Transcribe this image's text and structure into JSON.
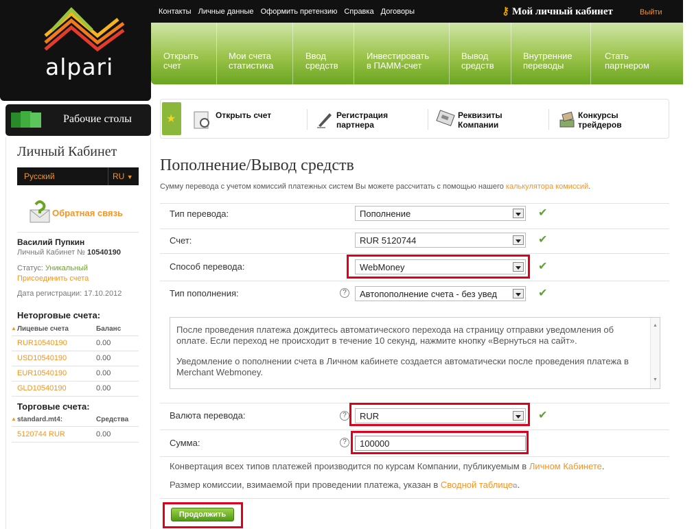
{
  "logo_text": "alpari",
  "sidebar": {
    "desks_label": "Рабочие столы",
    "cabinet_title": "Личный Кабинет",
    "language": "Русский",
    "language_code": "RU",
    "feedback": "Обратная связь",
    "user_name": "Василий Пупкин",
    "cabinet_no_label": "Личный Кабинет №",
    "cabinet_no": "10540190",
    "status_label": "Статус:",
    "status_value": "Уникальный",
    "join_accounts": "Присоединить счета",
    "reg_date": "Дата регистрации: 17.10.2012",
    "nontrading_title": "Неторговые счета:",
    "nontrading_cols": [
      "Лицевые счета",
      "Баланс"
    ],
    "nontrading_rows": [
      {
        "account": "RUR10540190",
        "balance": "0.00"
      },
      {
        "account": "USD10540190",
        "balance": "0.00"
      },
      {
        "account": "EUR10540190",
        "balance": "0.00"
      },
      {
        "account": "GLD10540190",
        "balance": "0.00"
      }
    ],
    "trading_title": "Торговые счета:",
    "trading_cols": [
      "standard.mt4:",
      "Средства"
    ],
    "trading_rows": [
      {
        "account": "5120744 RUR",
        "balance": "0.00"
      }
    ]
  },
  "topbar": {
    "links": [
      "Контакты",
      "Личные данные",
      "Оформить претензию",
      "Справка",
      "Договоры"
    ],
    "cabinet": "Мой личный кабинет",
    "exit": "Выйти"
  },
  "nav": [
    [
      "Открыть",
      "счет"
    ],
    [
      "Мои счета",
      "статистика"
    ],
    [
      "Ввод",
      "средств"
    ],
    [
      "Инвестировать",
      "в ПАММ-счет"
    ],
    [
      "Вывод",
      "средств"
    ],
    [
      "Внутренние",
      "переводы"
    ],
    [
      "Стать",
      "партнером"
    ]
  ],
  "quick_tabs": [
    [
      "Открыть счет",
      ""
    ],
    [
      "Регистрация",
      "партнера"
    ],
    [
      "Реквизиты",
      "Компании"
    ],
    [
      "Конкурсы",
      "трейдеров"
    ]
  ],
  "page": {
    "title": "Пополнение/Вывод средств",
    "intro": "Сумму перевода с учетом комиссий платежных систем Вы можете рассчитать с помощью нашего",
    "intro_link": "калькулятора комиссий",
    "intro_end": ".",
    "transfer_type_label": "Тип перевода:",
    "transfer_type_value": "Пополнение",
    "account_label": "Счет:",
    "account_value": "RUR 5120744",
    "method_label": "Способ перевода:",
    "method_value": "WebMoney",
    "deposit_type_label": "Тип пополнения:",
    "deposit_type_value": "Автопополнение счета - без увед",
    "info_p1": "После проведения платежа дождитесь автоматического перехода на страницу отправки уведомления об оплате. Если переход не происходит в течение 10 секунд, нажмите кнопку «Вернуться на сайт».",
    "info_p2": "Уведомление о пополнении счета в Личном кабинете создается автоматически после проведения платежа в Merchant Webmoney.",
    "currency_label": "Валюта перевода:",
    "currency_value": "RUR",
    "amount_label": "Сумма:",
    "amount_value": "100000",
    "note1": "Конвертация всех типов платежей производится по курсам Компании, публикуемым в",
    "note1_link": "Личном Кабинете",
    "note1_end": ".",
    "note2": "Размер комиссии, взимаемой при проведении платежа, указан в",
    "note2_link": "Сводной таблице",
    "note2_end": ".",
    "submit": "Продолжить"
  },
  "colors": {
    "accent": "#f7931e",
    "nav_green": "#8dbb3c",
    "highlight": "#e0001b",
    "check": "#5ea333"
  }
}
